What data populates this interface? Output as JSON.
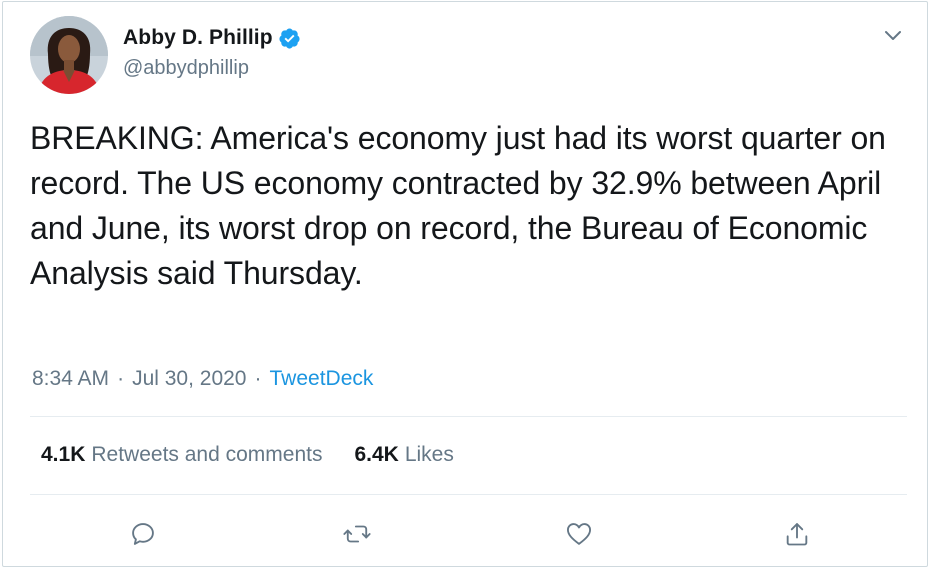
{
  "user": {
    "display_name": "Abby D. Phillip",
    "handle": "@abbydphillip",
    "verified": true,
    "avatar": "profile-photo",
    "verified_color": "#1da1f2"
  },
  "tweet": {
    "text": "BREAKING: America's economy just had its worst quarter on record. The US economy contracted by 32.9% between April and June, its worst drop on record, the Bureau of Economic Analysis said Thursday.",
    "time": "8:34 AM",
    "separator": "·",
    "date": "Jul 30, 2020",
    "source": "TweetDeck",
    "source_color": "#1b95e0"
  },
  "stats": {
    "retweets_count": "4.1K",
    "retweets_label": "Retweets and comments",
    "likes_count": "6.4K",
    "likes_label": "Likes"
  },
  "actions": [
    {
      "icon": "reply-icon"
    },
    {
      "icon": "retweet-icon"
    },
    {
      "icon": "like-heart-icon"
    },
    {
      "icon": "share-icon"
    }
  ],
  "menu": {
    "icon": "chevron-down-icon"
  }
}
